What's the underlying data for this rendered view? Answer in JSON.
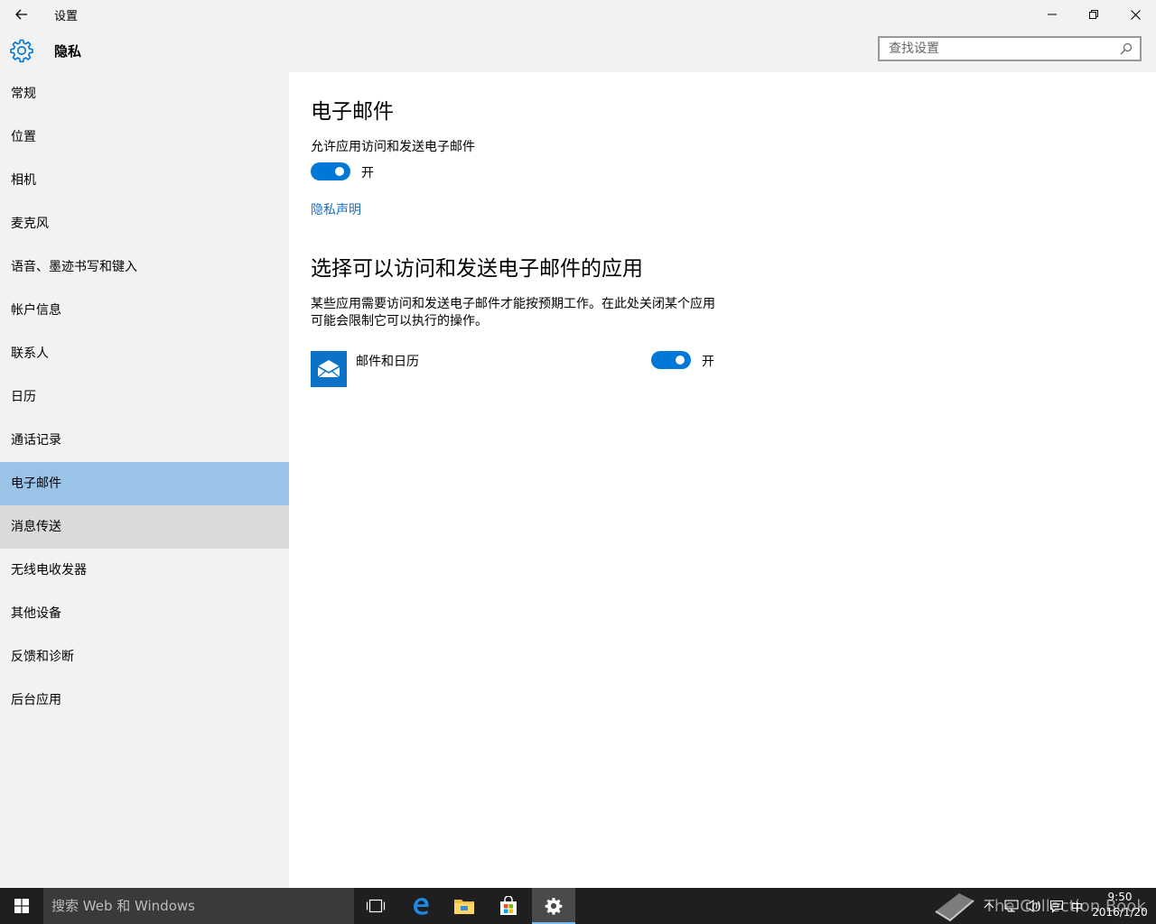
{
  "window": {
    "title": "设置",
    "page_title": "隐私"
  },
  "search": {
    "placeholder": "查找设置"
  },
  "sidebar": {
    "items": [
      {
        "label": "常规"
      },
      {
        "label": "位置"
      },
      {
        "label": "相机"
      },
      {
        "label": "麦克风"
      },
      {
        "label": "语音、墨迹书写和键入"
      },
      {
        "label": "帐户信息"
      },
      {
        "label": "联系人"
      },
      {
        "label": "日历"
      },
      {
        "label": "通话记录"
      },
      {
        "label": "电子邮件"
      },
      {
        "label": "消息传送"
      },
      {
        "label": "无线电收发器"
      },
      {
        "label": "其他设备"
      },
      {
        "label": "反馈和诊断"
      },
      {
        "label": "后台应用"
      }
    ],
    "selected_index": 9,
    "hover_index": 10
  },
  "content": {
    "heading": "电子邮件",
    "allow_label": "允许应用访问和发送电子邮件",
    "allow_toggle_state": "开",
    "privacy_link": "隐私声明",
    "apps_heading": "选择可以访问和发送电子邮件的应用",
    "apps_description": "某些应用需要访问和发送电子邮件才能按预期工作。在此处关闭某个应用可能会限制它可以执行的操作。",
    "apps": [
      {
        "name": "邮件和日历",
        "state": "开"
      }
    ]
  },
  "taskbar": {
    "search_placeholder": "搜索 Web 和 Windows",
    "watermark": "The Collection Book",
    "ime": "中",
    "time": "9:50",
    "date": "2016/1/20"
  },
  "colors": {
    "accent": "#0078d7",
    "selected_nav": "#99c4e8",
    "link": "#1a6fc0"
  }
}
